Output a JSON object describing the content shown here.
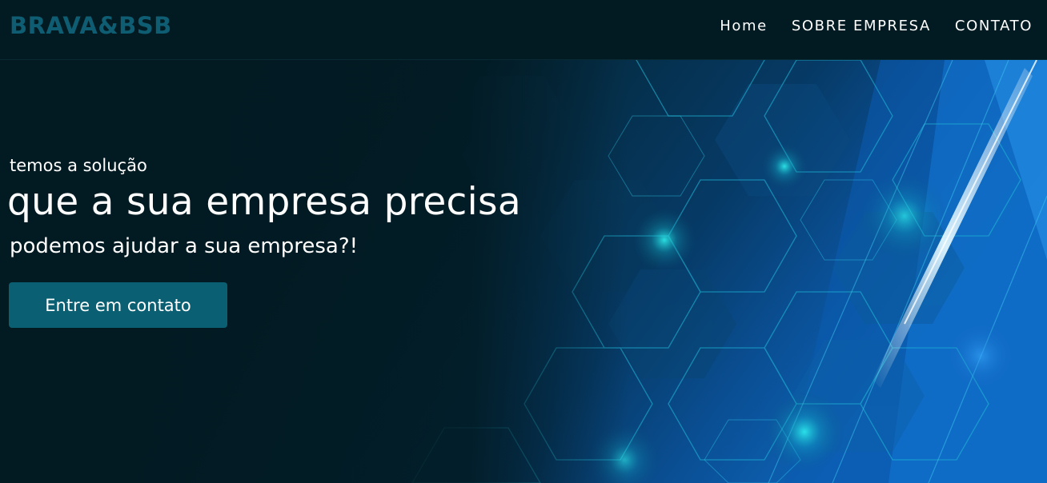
{
  "header": {
    "brand": "BRAVA&BSB",
    "nav": [
      {
        "label": "Home"
      },
      {
        "label": "SOBRE EMPRESA"
      },
      {
        "label": "CONTATO"
      }
    ]
  },
  "hero": {
    "eyebrow": "temos a solução",
    "title": "que a sua empresa precisa",
    "subtitle": "podemos ajudar a sua empresa?!",
    "cta_label": "Entre em contato",
    "background_image": "abstract-hexagon-technology-background"
  },
  "colors": {
    "header_bg": "#021a22",
    "brand": "#0e5d72",
    "cta_bg": "#0b5f72",
    "page_bg": "#03161e",
    "accent_glow": "#19d6e6",
    "accent_blue": "#1e8fe8"
  }
}
